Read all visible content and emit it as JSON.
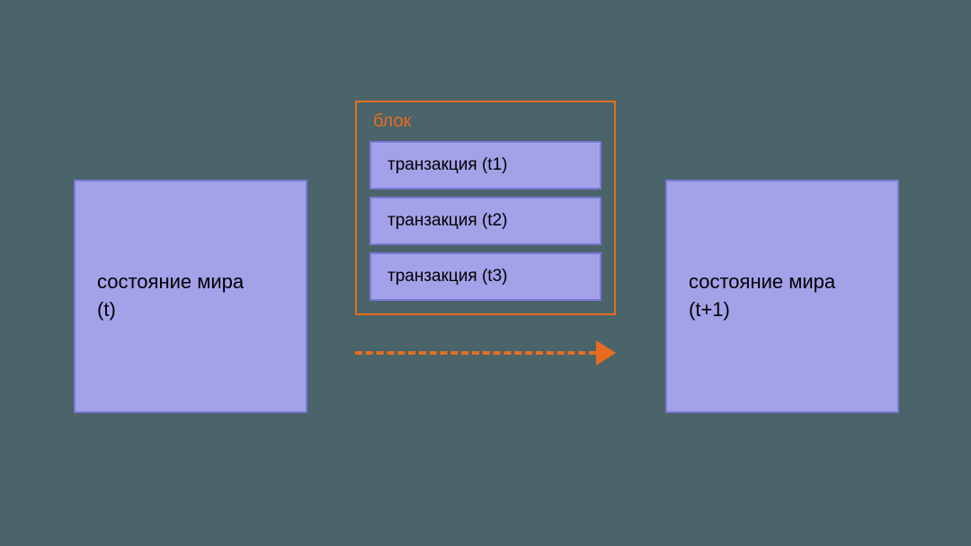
{
  "state_left": "состояние мира\n(t)",
  "state_right": "состояние мира\n(t+1)",
  "block": {
    "title": "блок",
    "transactions": [
      "транзакция (t1)",
      "транзакция (t2)",
      "транзакция (t3)"
    ]
  }
}
